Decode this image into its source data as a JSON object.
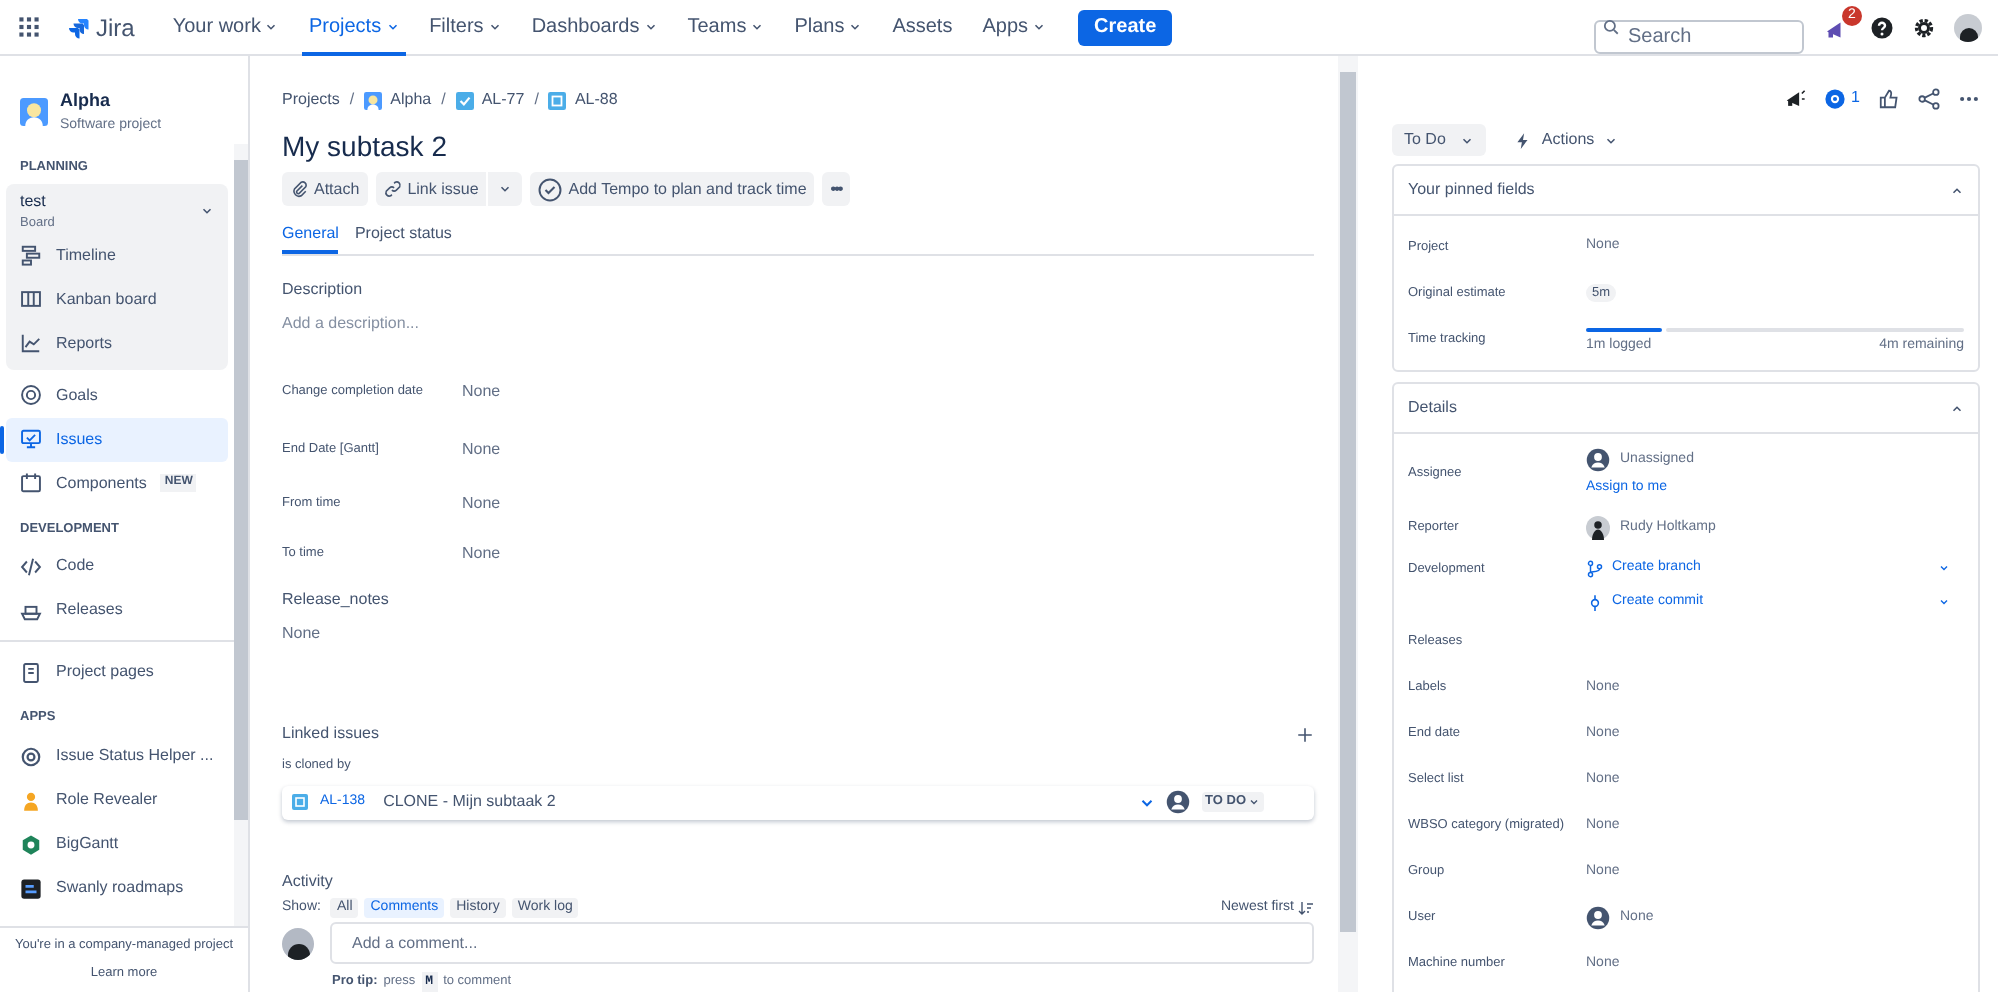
{
  "nav": {
    "logo": "Jira",
    "items": [
      {
        "label": "Your work",
        "selected": false,
        "dropdown": true
      },
      {
        "label": "Projects",
        "selected": true,
        "dropdown": true
      },
      {
        "label": "Filters",
        "selected": false,
        "dropdown": true
      },
      {
        "label": "Dashboards",
        "selected": false,
        "dropdown": true
      },
      {
        "label": "Teams",
        "selected": false,
        "dropdown": true
      },
      {
        "label": "Plans",
        "selected": false,
        "dropdown": true
      },
      {
        "label": "Assets",
        "selected": false,
        "dropdown": false
      },
      {
        "label": "Apps",
        "selected": false,
        "dropdown": true
      }
    ],
    "create": "Create",
    "search": {
      "placeholder": "Search"
    },
    "notifications": "2"
  },
  "sidebar": {
    "project": {
      "name": "Alpha",
      "type": "Software project"
    },
    "sections": [
      {
        "heading": "PLANNING",
        "board": {
          "name": "test",
          "subtitle": "Board",
          "expanded": true,
          "items": [
            {
              "label": "Timeline",
              "selected": false
            },
            {
              "label": "Kanban board",
              "selected": false
            },
            {
              "label": "Reports",
              "selected": false
            }
          ]
        },
        "items": [
          {
            "label": "Goals",
            "selected": false
          },
          {
            "label": "Issues",
            "selected": true
          },
          {
            "label": "Components",
            "selected": false,
            "badge": "NEW"
          }
        ]
      },
      {
        "heading": "DEVELOPMENT",
        "items": [
          {
            "label": "Code",
            "selected": false
          },
          {
            "label": "Releases",
            "selected": false
          }
        ]
      },
      {
        "items": [
          {
            "label": "Project pages",
            "selected": false
          }
        ]
      },
      {
        "heading": "APPS",
        "items": [
          {
            "label": "Issue Status Helper ...",
            "selected": false
          },
          {
            "label": "Role Revealer",
            "selected": false
          },
          {
            "label": "BigGantt",
            "selected": false
          },
          {
            "label": "Swanly roadmaps",
            "selected": false
          }
        ]
      }
    ],
    "footer": {
      "text": "You're in a company-managed project",
      "link": "Learn more"
    }
  },
  "issue": {
    "breadcrumbs": [
      {
        "label": "Projects"
      },
      {
        "separator": "/",
        "label": "Alpha"
      },
      {
        "separator": "/",
        "label": "AL-77"
      },
      {
        "separator": "/",
        "label": "AL-88"
      }
    ],
    "title": "My subtask 2",
    "toolbar": [
      {
        "label": "Attach",
        "split": false
      },
      {
        "label": "Link issue",
        "split": true
      },
      {
        "label": "Add Tempo to plan and track time",
        "split": false
      },
      {
        "label": "•••",
        "split": false
      }
    ],
    "tabs": [
      {
        "label": "General",
        "selected": true
      },
      {
        "label": "Project status",
        "selected": false
      }
    ],
    "description": {
      "label": "Description",
      "placeholder": "Add a description..."
    },
    "fields": [
      {
        "label": "Change completion date",
        "value": "None"
      },
      {
        "label": "End Date [Gantt]",
        "value": "None"
      },
      {
        "label": "From time",
        "value": "None"
      },
      {
        "label": "To time",
        "value": "None"
      }
    ],
    "release_notes": {
      "label": "Release_notes",
      "value": "None"
    },
    "linked_issues": {
      "title": "Linked issues",
      "relation": "is cloned by",
      "items": [
        {
          "key": "AL-138",
          "summary": "CLONE - Mijn subtaak 2",
          "status": "TO DO"
        }
      ]
    },
    "activity": {
      "title": "Activity",
      "show": "Show:",
      "filters": [
        {
          "label": "All",
          "selected": false
        },
        {
          "label": "Comments",
          "selected": true
        },
        {
          "label": "History",
          "selected": false
        },
        {
          "label": "Work log",
          "selected": false
        }
      ],
      "sort": "Newest first"
    },
    "comment": {
      "placeholder": "Add a comment...",
      "tip_label": "Pro tip:",
      "tip_before": "press",
      "tip_key": "M",
      "tip_after": "to comment"
    }
  },
  "details": {
    "watchers": "1",
    "status": "To Do",
    "actions": "Actions",
    "panels": [
      {
        "title": "Your pinned fields",
        "expanded": true,
        "fields": [
          {
            "kind": "text",
            "label": "Project",
            "value": "None"
          },
          {
            "kind": "chip",
            "label": "Original estimate",
            "value": "5m"
          },
          {
            "kind": "tracking",
            "label": "Time tracking",
            "level": 0.2,
            "logged": "1m logged",
            "remaining": "4m remaining"
          }
        ]
      },
      {
        "title": "Details",
        "expanded": true,
        "fields": [
          {
            "kind": "user",
            "label": "Assignee",
            "value": "Unassigned",
            "link": "Assign to me"
          },
          {
            "kind": "person",
            "label": "Reporter",
            "value": "Rudy Holtkamp"
          },
          {
            "kind": "dev",
            "label": "Development",
            "links": [
              "Create branch",
              "Create commit"
            ]
          },
          {
            "kind": "heading",
            "label": "Releases"
          },
          {
            "kind": "text",
            "label": "Labels",
            "value": "None"
          },
          {
            "kind": "text",
            "label": "End date",
            "value": "None"
          },
          {
            "kind": "text",
            "label": "Select list",
            "value": "None"
          },
          {
            "kind": "text",
            "label": "WBSO category (migrated)",
            "value": "None"
          },
          {
            "kind": "text",
            "label": "Group",
            "value": "None"
          },
          {
            "kind": "user",
            "label": "User",
            "value": "None"
          },
          {
            "kind": "text",
            "label": "Machine number",
            "value": "None"
          }
        ]
      }
    ]
  }
}
